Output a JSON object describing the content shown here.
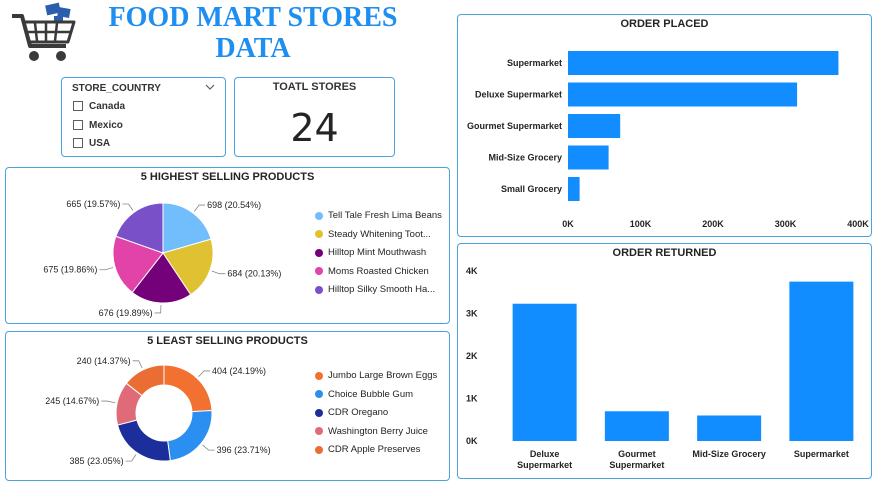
{
  "header": {
    "title_line1": "FOOD MART STORES",
    "title_line2": "DATA",
    "logo_icon": "shopping-cart-icon"
  },
  "slicer": {
    "title": "STORE_COUNTRY",
    "options": [
      "Canada",
      "Mexico",
      "USA"
    ]
  },
  "card": {
    "title": "TOATL STORES",
    "value": "24"
  },
  "colors": {
    "accent": "#1f8ef1",
    "bar": "#118dff",
    "border": "#4aa3df"
  },
  "chart_data": [
    {
      "type": "pie",
      "title": "5 HIGHEST SELLING PRODUCTS",
      "legend_position": "right",
      "slices": [
        {
          "label": "Tell Tale Fresh Lima Beans",
          "value": 698,
          "pct": "20.54%",
          "color": "#72bdfb",
          "data_label": "698 (20.54%)"
        },
        {
          "label": "Steady Whitening Toot...",
          "value": 684,
          "pct": "20.13%",
          "color": "#e0c132",
          "data_label": "684 (20.13%)"
        },
        {
          "label": "Hilltop Mint Mouthwash",
          "value": 676,
          "pct": "19.89%",
          "color": "#74007a",
          "data_label": "676 (19.89%)"
        },
        {
          "label": "Moms Roasted Chicken",
          "value": 675,
          "pct": "19.86%",
          "color": "#e243a9",
          "data_label": "675 (19.86%)"
        },
        {
          "label": "Hilltop Silky Smooth Ha...",
          "value": 665,
          "pct": "19.57%",
          "color": "#7950c8",
          "data_label": "665 (19.57%)"
        }
      ]
    },
    {
      "type": "pie",
      "subtype": "donut",
      "title": "5 LEAST SELLING PRODUCTS",
      "legend_position": "right",
      "slices": [
        {
          "label": "Jumbo Large Brown Eggs",
          "value": 404,
          "pct": "24.19%",
          "color": "#f27130",
          "data_label": "404 (24.19%)"
        },
        {
          "label": "Choice Bubble Gum",
          "value": 396,
          "pct": "23.71%",
          "color": "#2a8ff0",
          "data_label": "396 (23.71%)"
        },
        {
          "label": "CDR Oregano",
          "value": 385,
          "pct": "23.05%",
          "color": "#1c2d9c",
          "data_label": "385 (23.05%)"
        },
        {
          "label": "Washington Berry Juice",
          "value": 245,
          "pct": "14.67%",
          "color": "#e06b78",
          "data_label": "245 (14.67%)"
        },
        {
          "label": "CDR Apple Preserves",
          "value": 240,
          "pct": "14.37%",
          "color": "#ea6e33",
          "data_label": "240 (14.37%)"
        }
      ]
    },
    {
      "type": "bar",
      "orientation": "horizontal",
      "title": "ORDER PLACED",
      "categories": [
        "Supermarket",
        "Deluxe Supermarket",
        "Gourmet Supermarket",
        "Mid-Size Grocery",
        "Small Grocery"
      ],
      "values": [
        373000,
        316000,
        72000,
        56000,
        16000
      ],
      "xlim": [
        0,
        400000
      ],
      "ticks": [
        0,
        100000,
        200000,
        300000,
        400000
      ],
      "tick_labels": [
        "0K",
        "100K",
        "200K",
        "300K",
        "400K"
      ],
      "grid": false
    },
    {
      "type": "bar",
      "orientation": "vertical",
      "title": "ORDER RETURNED",
      "categories": [
        "Deluxe Supermarket",
        "Gourmet Supermarket",
        "Mid-Size Grocery",
        "Supermarket"
      ],
      "category_lines": [
        [
          "Deluxe",
          "Supermarket"
        ],
        [
          "Gourmet",
          "Supermarket"
        ],
        [
          "Mid-Size Grocery"
        ],
        [
          "Supermarket"
        ]
      ],
      "values": [
        3230,
        700,
        600,
        3750
      ],
      "ylim": [
        0,
        4000
      ],
      "ticks": [
        0,
        1000,
        2000,
        3000,
        4000
      ],
      "tick_labels": [
        "0K",
        "1K",
        "2K",
        "3K",
        "4K"
      ],
      "grid": false
    }
  ]
}
